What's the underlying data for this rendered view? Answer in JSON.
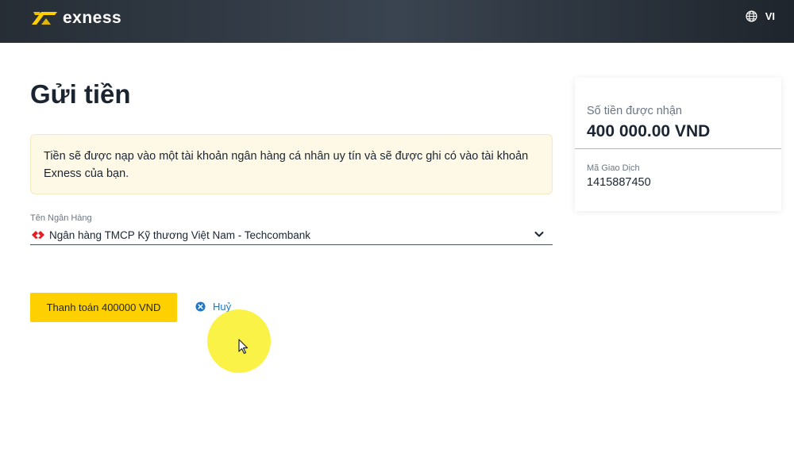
{
  "header": {
    "brand": "exness",
    "language": "VI"
  },
  "page": {
    "title": "Gửi tiền"
  },
  "notice": {
    "text_line1": "Tiền sẽ được nạp vào một tài khoản ngân hàng cá nhân uy tín và sẽ được ghi có vào tài khoản",
    "text_line2": "Exness của bạn."
  },
  "bank_field": {
    "label": "Tên Ngân Hàng",
    "selected": "Ngân hàng TMCP Kỹ thương Việt Nam - Techcombank"
  },
  "actions": {
    "pay_label": "Thanh toán 400000 VND",
    "cancel_label": "Huỷ"
  },
  "summary": {
    "received_label": "Số tiền được nhận",
    "received_amount": "400 000.00 VND",
    "transaction_label": "Mã Giao Dịch",
    "transaction_id": "1415887450"
  },
  "colors": {
    "accent_yellow": "#ffd000",
    "link_blue": "#1e78c8",
    "notice_bg": "#fef9e7",
    "header_dark": "#2b323a",
    "bank_red": "#e31e24"
  },
  "icons": {
    "logo": "exness-logo-icon",
    "language": "globe-icon",
    "bank": "techcombank-logo-icon",
    "dropdown": "chevron-down-icon",
    "cancel": "close-circle-icon",
    "cursor": "mouse-pointer-icon"
  }
}
